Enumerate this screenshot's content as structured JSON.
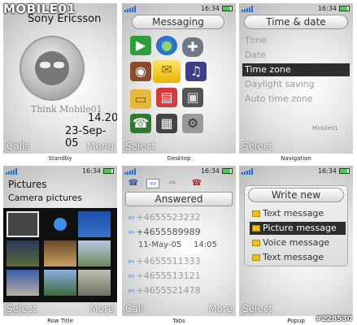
{
  "watermark": "MOBILE01",
  "credit": "#228530",
  "captions": [
    "Standby",
    "Desktop",
    "Navigation",
    "Row Title",
    "Tabs",
    "Popup"
  ],
  "status_time": "16:34",
  "standby": {
    "operator": "Sony Ericsson",
    "tagline": "Think Mobile01",
    "time": "14.20",
    "date": "23-Sep-05",
    "soft_left": "Calls",
    "soft_right": "Menu"
  },
  "desktop": {
    "title": "Messaging",
    "soft_left": "Select",
    "icons": [
      "play-icon",
      "globe-icon",
      "gamepad-icon",
      "camera-icon",
      "envelope-icon",
      "media-icon",
      "folder-icon",
      "notebook-icon",
      "radio-icon",
      "contacts-icon",
      "calendar-icon",
      "settings-icon"
    ]
  },
  "navigation": {
    "title": "Time & date",
    "items": [
      "Time",
      "Date",
      "Time zone",
      "Daylight saving",
      "Auto time zone"
    ],
    "selected_index": 2,
    "soft_left": "Select",
    "footer_brand": "Mobile01"
  },
  "row_title": {
    "title": "Pictures",
    "subtitle": "Camera pictures",
    "soft_left": "Select",
    "soft_right": "More"
  },
  "tabs": {
    "title": "Answered",
    "calls": [
      "+4655523232",
      "+4655589989",
      "+4655511333",
      "+4655513121",
      "+4655521478"
    ],
    "selected_index": 1,
    "selected_date": "11-May-05",
    "selected_time": "14:05",
    "soft_left": "Call",
    "soft_right": "More"
  },
  "popup": {
    "title": "Write new",
    "items": [
      "Text message",
      "Picture message",
      "Voice message",
      "Text message"
    ],
    "selected_index": 1,
    "soft_left": "Select"
  },
  "colors": {
    "selection": "#2e2e2e",
    "signal": "#2a6fd1",
    "accent_yellow": "#f2c10f"
  }
}
